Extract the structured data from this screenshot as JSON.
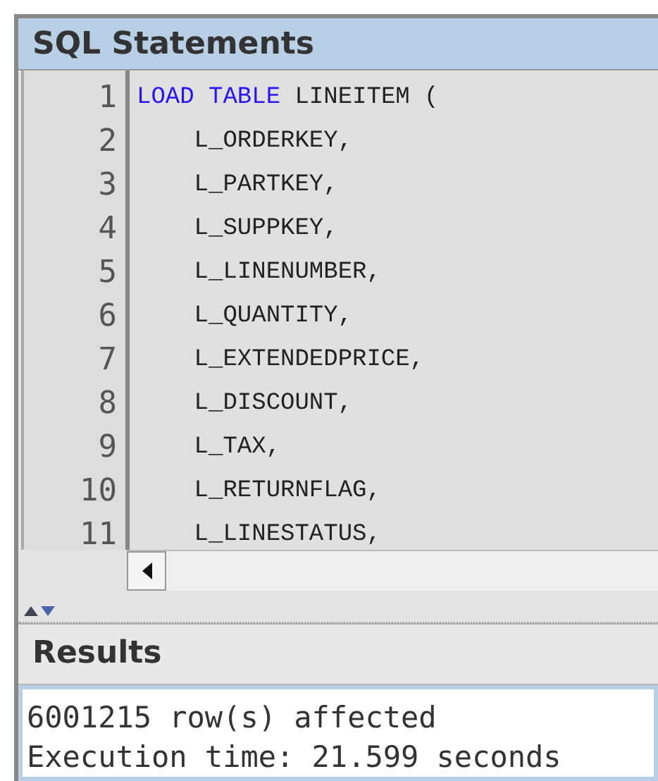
{
  "sql_panel": {
    "title": "SQL Statements",
    "lines": [
      {
        "number": "1",
        "tokens": [
          {
            "kind": "keyword",
            "text": "LOAD TABLE"
          },
          {
            "kind": "plain",
            "text": " LINEITEM ("
          }
        ]
      },
      {
        "number": "2",
        "tokens": [
          {
            "kind": "plain",
            "text": "    L_ORDERKEY,"
          }
        ]
      },
      {
        "number": "3",
        "tokens": [
          {
            "kind": "plain",
            "text": "    L_PARTKEY,"
          }
        ]
      },
      {
        "number": "4",
        "tokens": [
          {
            "kind": "plain",
            "text": "    L_SUPPKEY,"
          }
        ]
      },
      {
        "number": "5",
        "tokens": [
          {
            "kind": "plain",
            "text": "    L_LINENUMBER,"
          }
        ]
      },
      {
        "number": "6",
        "tokens": [
          {
            "kind": "plain",
            "text": "    L_QUANTITY,"
          }
        ]
      },
      {
        "number": "7",
        "tokens": [
          {
            "kind": "plain",
            "text": "    L_EXTENDEDPRICE,"
          }
        ]
      },
      {
        "number": "8",
        "tokens": [
          {
            "kind": "plain",
            "text": "    L_DISCOUNT,"
          }
        ]
      },
      {
        "number": "9",
        "tokens": [
          {
            "kind": "plain",
            "text": "    L_TAX,"
          }
        ]
      },
      {
        "number": "10",
        "tokens": [
          {
            "kind": "plain",
            "text": "    L_RETURNFLAG,"
          }
        ]
      },
      {
        "number": "11",
        "tokens": [
          {
            "kind": "plain",
            "text": "    L_LINESTATUS,"
          }
        ]
      }
    ]
  },
  "results_panel": {
    "title": "Results",
    "lines": [
      "6001215 row(s) affected",
      "Execution time: 21.599 seconds"
    ]
  }
}
